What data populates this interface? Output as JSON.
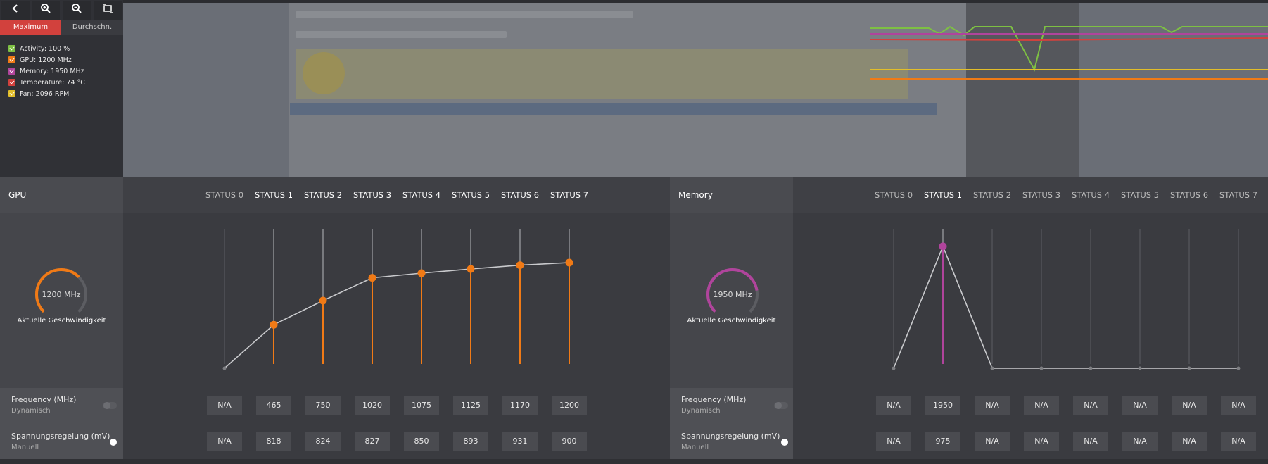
{
  "toolbar": {
    "back_icon": "chevron-left-icon",
    "zoom_in_icon": "zoom-in-icon",
    "zoom_out_icon": "zoom-out-icon",
    "fit_icon": "fit-icon"
  },
  "monitor": {
    "tabs": [
      {
        "label": "Maximum",
        "active": true
      },
      {
        "label": "Durchschn.",
        "active": false
      }
    ],
    "legend": [
      {
        "label": "Activity: 100 %",
        "color": "#7ec043"
      },
      {
        "label": "GPU: 1200 MHz",
        "color": "#f07a16"
      },
      {
        "label": "Memory: 1950 MHz",
        "color": "#b0449c"
      },
      {
        "label": "Temperature: 74 °C",
        "color": "#d2413d"
      },
      {
        "label": "Fan: 2096 RPM",
        "color": "#e2be2a"
      }
    ]
  },
  "gpu": {
    "title": "GPU",
    "states": [
      "STATUS 0",
      "STATUS 1",
      "STATUS 2",
      "STATUS 3",
      "STATUS 4",
      "STATUS 5",
      "STATUS 6",
      "STATUS 7"
    ],
    "gauge_value": "1200 MHz",
    "gauge_caption": "Aktuelle Geschwindigkeit",
    "gauge_color": "#f07a16",
    "gauge_fraction": 0.67,
    "freq_label": "Frequency (MHz)",
    "freq_sub": "Dynamisch",
    "volt_label": "Spannungsregelung (mV)",
    "volt_sub": "Manuell",
    "frequencies": [
      "N/A",
      "465",
      "750",
      "1020",
      "1075",
      "1125",
      "1170",
      "1200"
    ],
    "voltages": [
      "N/A",
      "818",
      "824",
      "827",
      "850",
      "893",
      "931",
      "900"
    ]
  },
  "memory": {
    "title": "Memory",
    "states": [
      "STATUS 0",
      "STATUS 1",
      "STATUS 2",
      "STATUS 3",
      "STATUS 4",
      "STATUS 5",
      "STATUS 6",
      "STATUS 7"
    ],
    "gauge_value": "1950 MHz",
    "gauge_caption": "Aktuelle Geschwindigkeit",
    "gauge_color": "#b0449c",
    "gauge_fraction": 0.8,
    "freq_label": "Frequency (MHz)",
    "freq_sub": "Dynamisch",
    "volt_label": "Spannungsregelung (mV)",
    "volt_sub": "Manuell",
    "frequencies": [
      "N/A",
      "1950",
      "N/A",
      "N/A",
      "N/A",
      "N/A",
      "N/A",
      "N/A"
    ],
    "voltages": [
      "N/A",
      "975",
      "N/A",
      "N/A",
      "N/A",
      "N/A",
      "N/A",
      "N/A"
    ]
  }
}
